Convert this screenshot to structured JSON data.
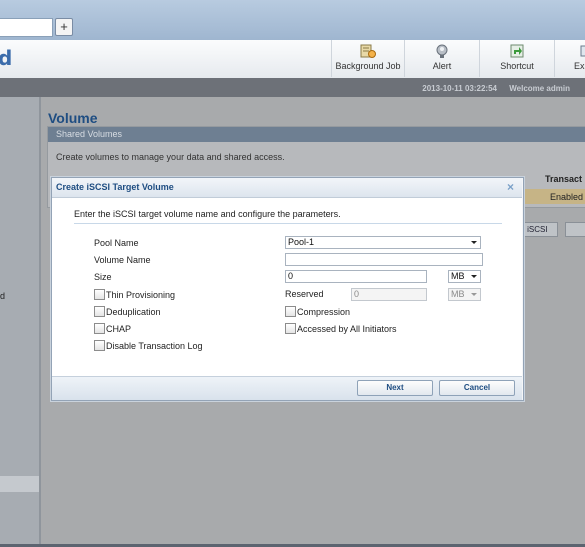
{
  "browser": {
    "new_tab_label": "+"
  },
  "header": {
    "logo_text": "d",
    "buttons": [
      {
        "label": "Background Job",
        "icon": "background-job-icon"
      },
      {
        "label": "Alert",
        "icon": "alert-icon"
      },
      {
        "label": "Shortcut",
        "icon": "shortcut-icon"
      },
      {
        "label": "Exp",
        "icon": "export-icon"
      }
    ]
  },
  "status": {
    "datetime": "2013-10-11 03:22:54",
    "welcome": "Welcome admin"
  },
  "sidebar": {
    "partial_text": "d"
  },
  "page": {
    "title": "Volume",
    "panel_title": "Shared Volumes",
    "panel_description": "Create volumes to manage your data and shared access.",
    "column_header": "Transact",
    "row_status": "Enabled",
    "iscsi_button": "e iSCSI"
  },
  "dialog": {
    "title": "Create iSCSI Target Volume",
    "close_symbol": "×",
    "intro": "Enter the iSCSI target volume name and configure the parameters.",
    "pool_name_label": "Pool Name",
    "pool_name_value": "Pool-1",
    "volume_name_label": "Volume Name",
    "volume_name_value": "",
    "size_label": "Size",
    "size_value": "0",
    "size_unit": "MB",
    "thin_provisioning_label": "Thin Provisioning",
    "reserved_label": "Reserved",
    "reserved_value": "0",
    "reserved_unit": "MB",
    "deduplication_label": "Deduplication",
    "compression_label": "Compression",
    "chap_label": "CHAP",
    "accessed_by_all_label": "Accessed by All Initiators",
    "disable_log_label": "Disable Transaction Log",
    "next_label": "Next",
    "cancel_label": "Cancel"
  },
  "colors": {
    "accent": "#1e4d82",
    "status_bar": "#6d7178",
    "enabled_row": "#c6b486"
  }
}
